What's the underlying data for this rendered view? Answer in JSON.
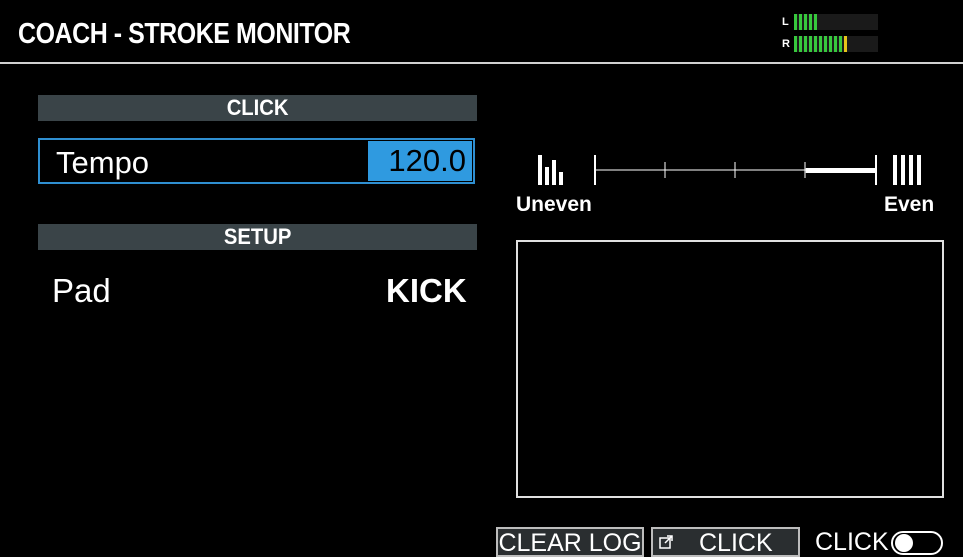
{
  "header": {
    "title": "COACH - STROKE MONITOR",
    "meter": {
      "left_label": "L",
      "right_label": "R",
      "left_level": 0.28,
      "right_level": 0.64,
      "colors": {
        "green": "#37c83d",
        "yellow": "#e6c51a"
      }
    }
  },
  "click_section": {
    "title": "CLICK",
    "tempo_label": "Tempo",
    "tempo_value": "120.0"
  },
  "setup_section": {
    "title": "SETUP",
    "pad_label": "Pad",
    "pad_value": "KICK"
  },
  "evenness": {
    "left_label": "Uneven",
    "right_label": "Even",
    "left_icon": "uneven-bars-icon",
    "right_icon": "even-bars-icon",
    "level": 0.8
  },
  "footer": {
    "clear_log_label": "CLEAR LOG",
    "click_button_label": "CLICK",
    "click_button_icon": "external-link-icon",
    "click_toggle_label": "CLICK",
    "click_toggle_on": false
  },
  "colors": {
    "accent": "#2f9ae0",
    "section_bar": "#3a4448",
    "background": "#000000"
  }
}
